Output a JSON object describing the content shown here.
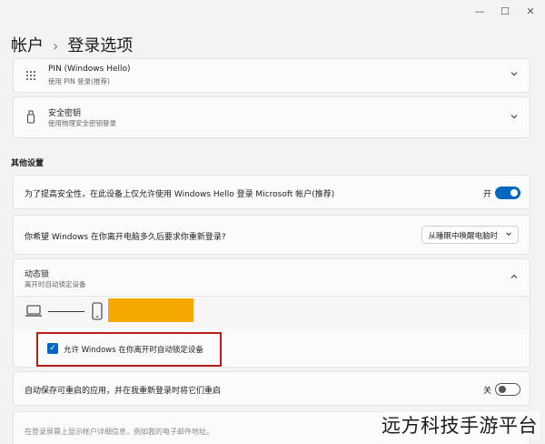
{
  "window": {
    "minimize_glyph": "—",
    "maximize_glyph": "☐",
    "close_glyph": "✕"
  },
  "breadcrumb": {
    "parent": "帐户",
    "separator": "›",
    "current": "登录选项"
  },
  "pin_card": {
    "title": "PIN (Windows Hello)",
    "subtitle": "使用 PIN 登录(推荐)",
    "icon": "keypad-icon"
  },
  "security_key_card": {
    "title": "安全密钥",
    "subtitle": "使用物理安全密钥登录",
    "icon": "usb-key-icon"
  },
  "other_settings": {
    "heading": "其他设置",
    "hello_only": {
      "text": "为了提高安全性，在此设备上仅允许使用 Windows Hello 登录 Microsoft 帐户(推荐)",
      "toggle_label": "开",
      "toggle_on": true
    },
    "away_signin": {
      "text": "你希望 Windows 在你离开电脑多久后要求你重新登录?",
      "dropdown_value": "从睡眠中唤醒电脑时"
    },
    "dynamic_lock": {
      "title": "动态锁",
      "subtitle": "离开时自动锁定设备",
      "checkbox_label": "允许 Windows 在你离开时自动锁定设备",
      "checkbox_checked": true
    },
    "restart_apps": {
      "text": "自动保存可重启的应用，并在我重新登录时将它们重启",
      "toggle_label": "关",
      "toggle_on": false
    },
    "lock_screen_details": {
      "text": "在登录屏幕上显示帐户详细信息，例如我的电子邮件地址。"
    }
  },
  "colors": {
    "accent": "#0067c0",
    "highlight_orange": "#f5a800",
    "annotation_red": "#b71c1c"
  },
  "watermark": "远方科技手游平台"
}
